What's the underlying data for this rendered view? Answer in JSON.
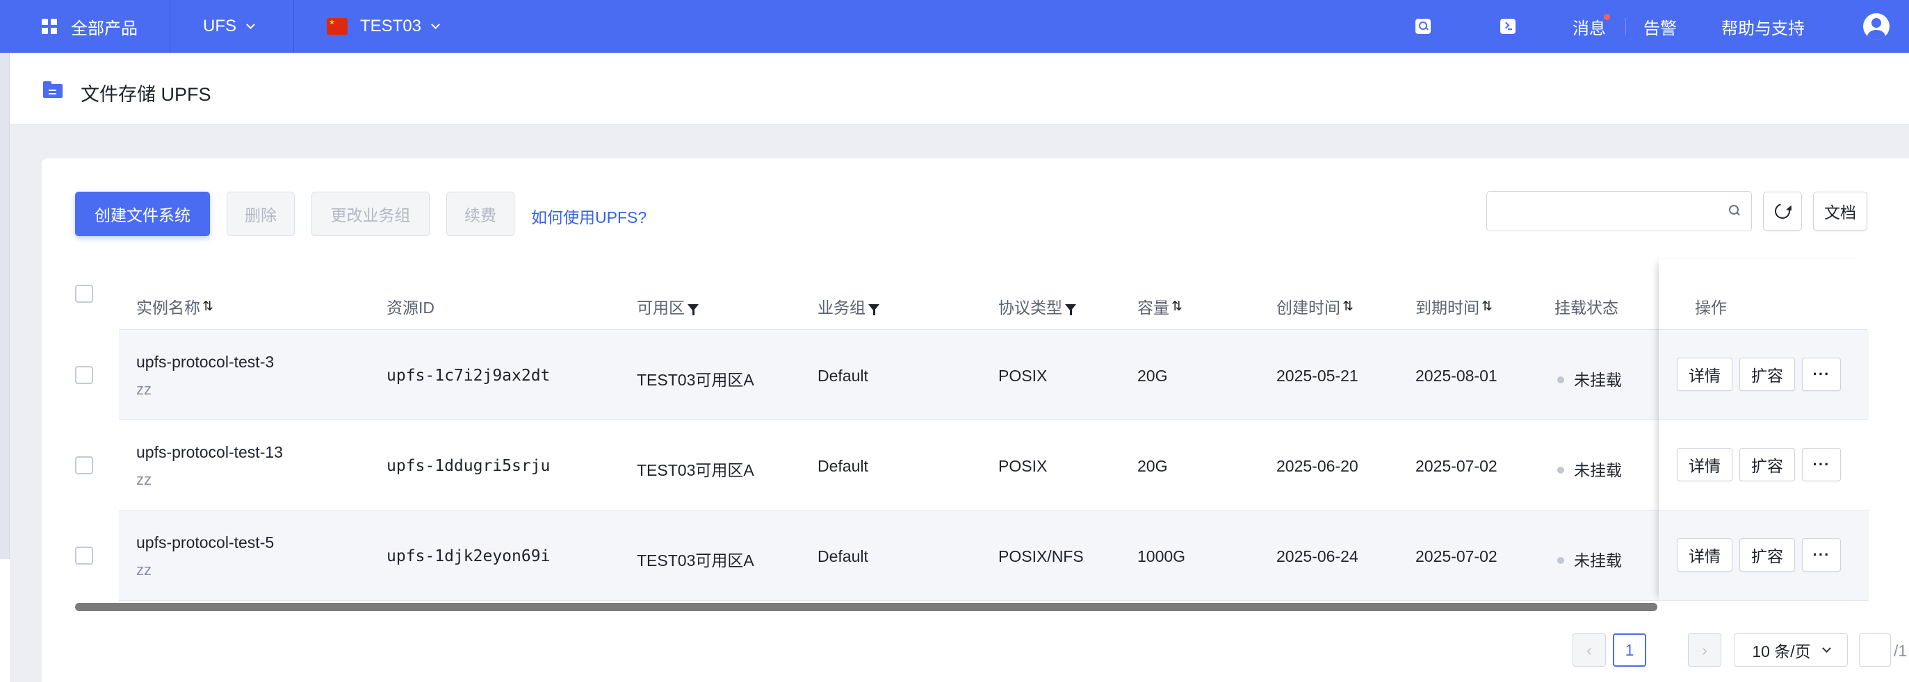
{
  "topbar": {
    "all_products": "全部产品",
    "product": "UFS",
    "region": "TEST03",
    "messages": "消息",
    "alerts": "告警",
    "help": "帮助与支持",
    "icons": [
      "apps-icon",
      "search-icon",
      "terminal-icon",
      "avatar-icon"
    ],
    "accent_color": "#4a6cf2"
  },
  "page": {
    "title": "文件存储 UPFS"
  },
  "toolbar": {
    "create": "创建文件系统",
    "delete": "删除",
    "change_group": "更改业务组",
    "renew": "续费",
    "help_link": "如何使用UPFS?",
    "search_placeholder": "",
    "docs": "文档"
  },
  "table": {
    "columns": {
      "name": "实例名称",
      "resource_id": "资源ID",
      "zone": "可用区",
      "group": "业务组",
      "protocol": "协议类型",
      "capacity": "容量",
      "created": "创建时间",
      "expires": "到期时间",
      "mount": "挂载状态",
      "ops": "操作"
    },
    "rows": [
      {
        "name": "upfs-protocol-test-3",
        "remark": "zz",
        "resource_id": "upfs-1c7i2j9ax2dt",
        "zone": "TEST03可用区A",
        "group": "Default",
        "protocol": "POSIX",
        "capacity": "20G",
        "created": "2025-05-21",
        "expires": "2025-08-01",
        "mount": "未挂载"
      },
      {
        "name": "upfs-protocol-test-13",
        "remark": "zz",
        "resource_id": "upfs-1ddugri5srju",
        "zone": "TEST03可用区A",
        "group": "Default",
        "protocol": "POSIX",
        "capacity": "20G",
        "created": "2025-06-20",
        "expires": "2025-07-02",
        "mount": "未挂载"
      },
      {
        "name": "upfs-protocol-test-5",
        "remark": "zz",
        "resource_id": "upfs-1djk2eyon69i",
        "zone": "TEST03可用区A",
        "group": "Default",
        "protocol": "POSIX/NFS",
        "capacity": "1000G",
        "created": "2025-06-24",
        "expires": "2025-07-02",
        "mount": "未挂载"
      }
    ],
    "ops": {
      "details": "详情",
      "expand": "扩容",
      "more": "···"
    }
  },
  "pagination": {
    "current": "1",
    "page_size": "10 条/页",
    "jump_value": "",
    "total": "/1"
  }
}
